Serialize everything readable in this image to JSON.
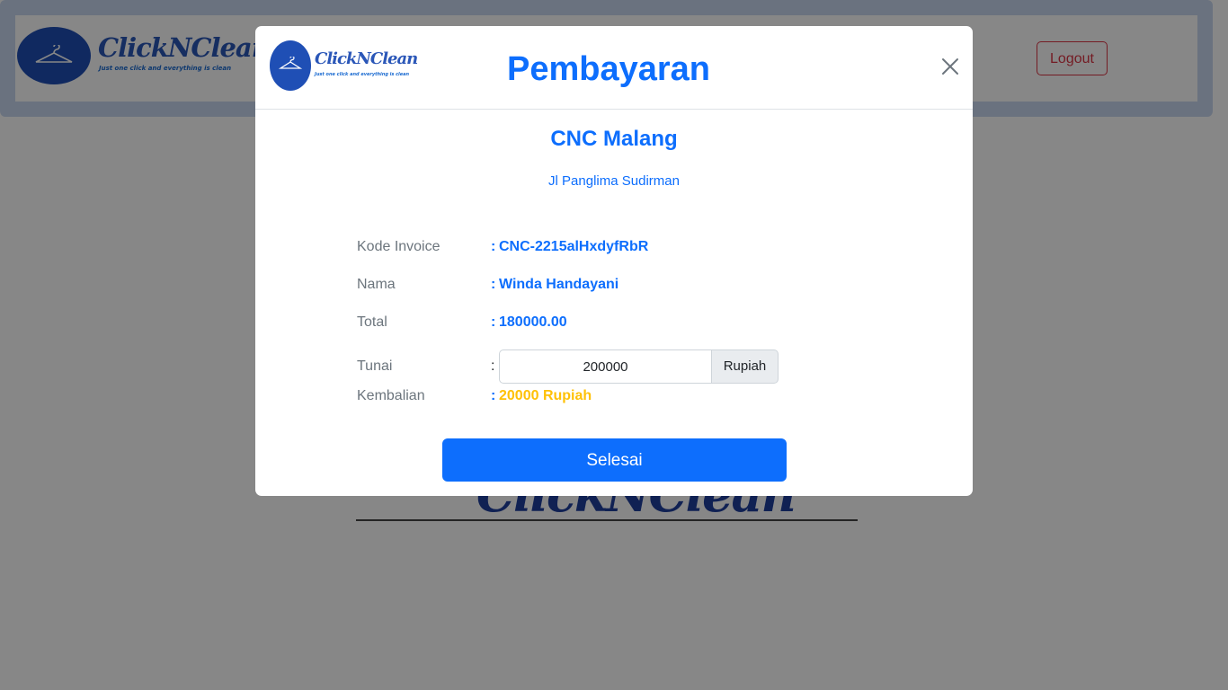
{
  "background": {
    "brand": {
      "name": "ClickNClean",
      "tagline": "Just one click and everything is clean"
    },
    "logout_label": "Logout",
    "watermark": "ClickNClean"
  },
  "modal": {
    "logo": {
      "name": "ClickNClean",
      "tagline": "Just one click and everything is clean"
    },
    "title": "Pembayaran",
    "store": {
      "name": "CNC Malang",
      "address": "Jl Panglima Sudirman"
    },
    "fields": [
      {
        "label": "Kode Invoice",
        "value": "CNC-2215alHxdyfRbR"
      },
      {
        "label": "Nama",
        "value": "Winda Handayani"
      },
      {
        "label": "Total",
        "value": "180000.00"
      }
    ],
    "cash": {
      "label": "Tunai",
      "value": "200000",
      "addon": "Rupiah"
    },
    "change": {
      "label": "Kembalian",
      "value": "20000 Rupiah"
    },
    "colon": ":",
    "finish_label": "Selesai"
  },
  "colors": {
    "primary": "#0d6efd",
    "danger": "#dc3545",
    "warning": "#ffc107",
    "muted": "#6c757d",
    "brand_blue": "#1f4fb5"
  },
  "icons": {
    "close": "close-icon",
    "hanger": "hanger-icon"
  }
}
